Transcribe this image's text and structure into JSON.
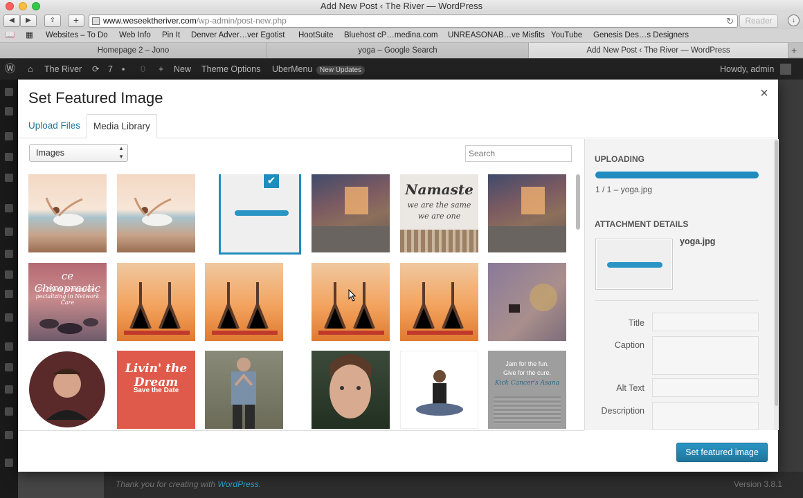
{
  "browser": {
    "window_title": "Add New Post ‹ The River — WordPress",
    "url_host": "www.weseektheriver.com",
    "url_path": "/wp-admin/post-new.php",
    "reader_label": "Reader",
    "bookmarks": [
      "Websites – To Do",
      "Web Info",
      "Pin It",
      "Denver Adver…ver Egotist",
      "HootSuite",
      "Bluehost cP…medina.com",
      "UNREASONAB…ve Misfits",
      "YouTube",
      "Genesis Des…s Designers"
    ],
    "tabs": [
      "Homepage 2 – Jono",
      "yoga – Google Search",
      "Add New Post ‹ The River — WordPress"
    ]
  },
  "adminbar": {
    "site_name": "The River",
    "updates_count": "7",
    "comments_count": "0",
    "new_label": "New",
    "theme_options": "Theme Options",
    "ubermenu": "UberMenu",
    "new_updates_badge": "New Updates",
    "howdy": "Howdy, admin"
  },
  "modal": {
    "title": "Set Featured Image",
    "close_icon": "×",
    "tabs": {
      "upload": "Upload Files",
      "library": "Media Library"
    },
    "filter_value": "Images",
    "search_placeholder": "Search",
    "check_icon": "✔",
    "thumbs": {
      "namaste_line1": "Namaste",
      "namaste_line2": "we are the same",
      "namaste_line3": "we are one",
      "chiro_title": "ce Chiropractic",
      "chiro_name": "Dr. Mark Armbruster",
      "chiro_sub": "pecializing in Network Care",
      "livin_title": "Livin' the Dream",
      "livin_sub": "Save the Date",
      "jam_line1": "Jam for the fun.",
      "jam_line2": "Give for the cure.",
      "jam_line3": "Kick Cancer's Asana"
    },
    "sidebar": {
      "uploading_heading": "Uploading",
      "progress_text": "1 / 1  –  yoga.jpg",
      "progress_value": 1.0,
      "attachment_heading": "Attachment Details",
      "filename": "yoga.jpg",
      "fields": {
        "title_label": "Title",
        "caption_label": "Caption",
        "alt_label": "Alt Text",
        "description_label": "Description"
      }
    },
    "set_button": "Set featured image"
  },
  "footer": {
    "thanks_prefix": "Thank you for creating with ",
    "thanks_link": "WordPress",
    "thanks_suffix": ".",
    "version": "Version 3.8.1"
  }
}
